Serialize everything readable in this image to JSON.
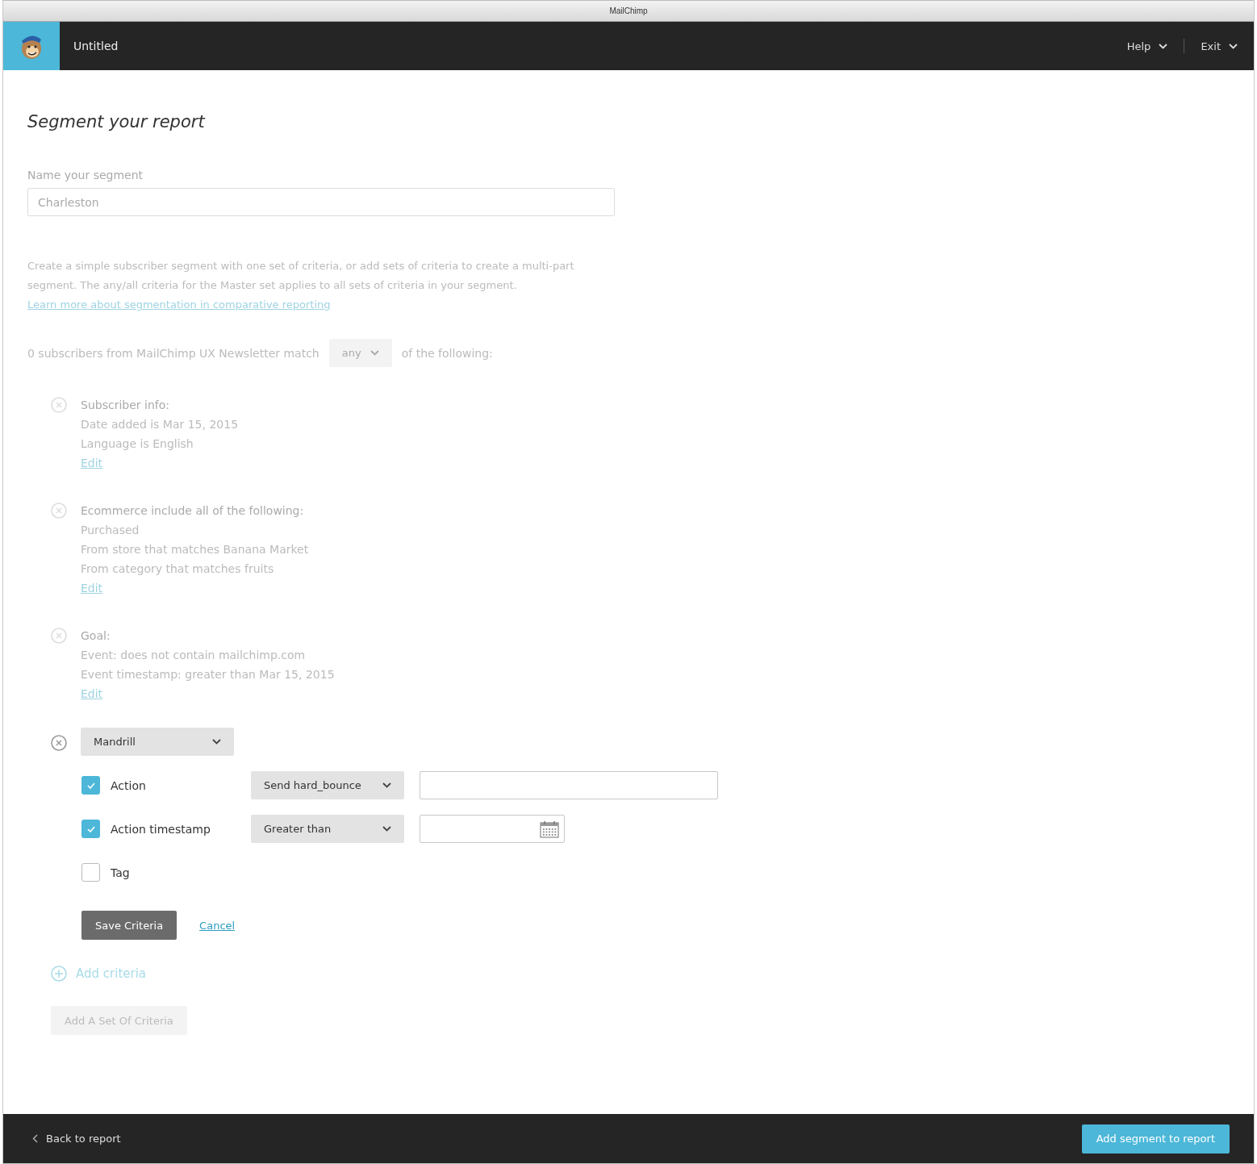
{
  "window": {
    "title": "MailChimp"
  },
  "header": {
    "title": "Untitled",
    "menus": [
      {
        "label": "Help"
      },
      {
        "label": "Exit"
      }
    ]
  },
  "page_title": "Segment your report",
  "segment_name": {
    "label": "Name your segment",
    "value": "Charleston"
  },
  "intro": {
    "text": "Create a simple subscriber segment with one set of criteria, or add sets of criteria to create a multi-part segment. The any/all criteria for the Master set applies to all sets of criteria in your segment.",
    "link": "Learn more about segmentation in comparative reporting"
  },
  "match": {
    "prefix": "0 subscribers from MailChimp UX Newsletter match",
    "value": "any",
    "suffix": "of the following:"
  },
  "criteria": [
    {
      "kind": "summary",
      "title": "Subscriber info:",
      "lines": [
        "Date added is Mar 15, 2015",
        "Language is English"
      ],
      "edit": "Edit"
    },
    {
      "kind": "summary",
      "title": "Ecommerce include all of the following:",
      "lines": [
        "Purchased",
        "From store that matches Banana Market",
        "From category that matches fruits"
      ],
      "edit": "Edit"
    },
    {
      "kind": "summary",
      "title": "Goal:",
      "lines": [
        "Event: does not contain mailchimp.com",
        "Event timestamp: greater than Mar 15, 2015"
      ],
      "edit": "Edit"
    },
    {
      "kind": "editor",
      "source": "Mandrill",
      "options": [
        {
          "kind": "text",
          "label": "Action",
          "checked": true,
          "operator": "Send hard_bounce"
        },
        {
          "kind": "date",
          "label": "Action timestamp",
          "checked": true,
          "operator": "Greater than"
        },
        {
          "kind": "plain",
          "label": "Tag",
          "checked": false
        }
      ],
      "save": "Save Criteria",
      "cancel": "Cancel"
    }
  ],
  "add_criteria": "Add criteria",
  "add_set": "Add A Set Of Criteria",
  "footer": {
    "back": "Back to report",
    "primary": "Add segment to report"
  }
}
